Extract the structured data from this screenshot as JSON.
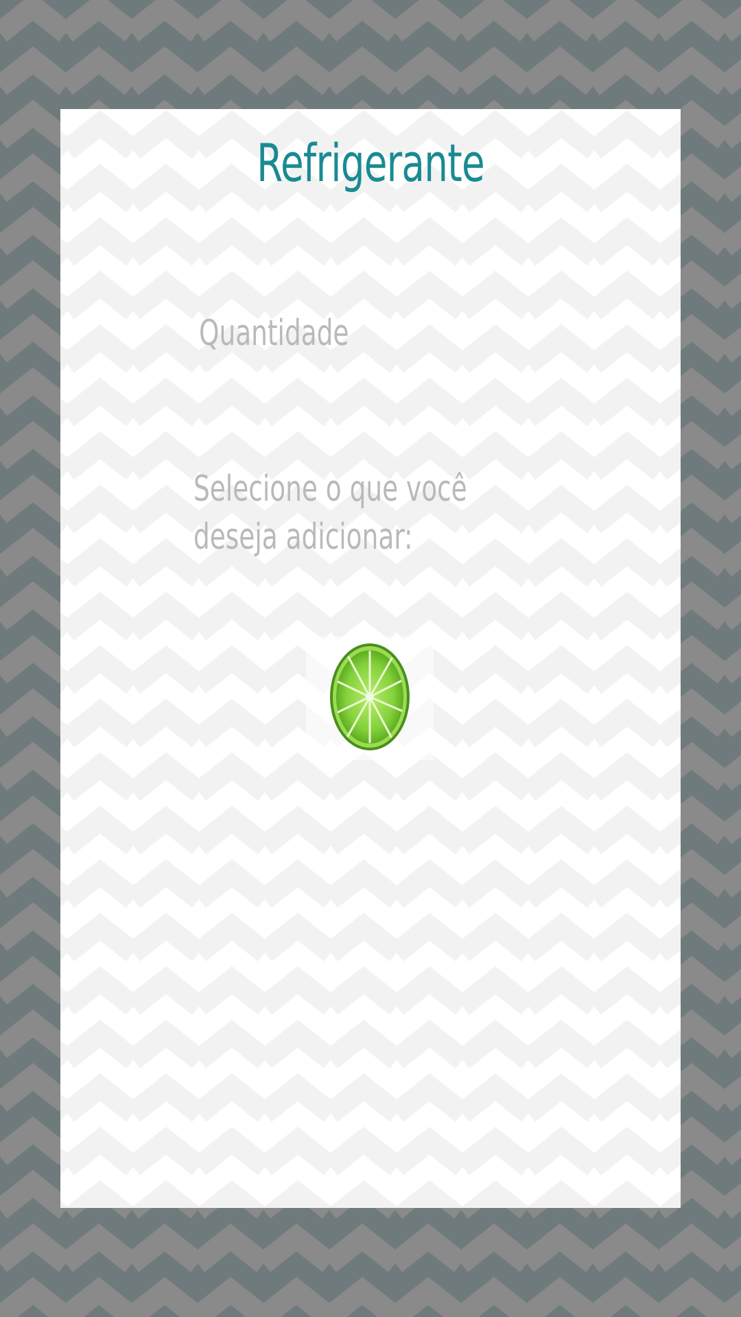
{
  "screen": {
    "title": "Refrigerante",
    "quantity_label": "Quantidade",
    "addons_prompt": "Selecione o que você deseja adicionar:"
  },
  "addons": [
    {
      "icon": "lime-slice-icon"
    }
  ],
  "colors": {
    "title": "#1a8a92",
    "label": "#b9b9b9",
    "outer_background": "#6f7a7c",
    "outer_chevron": "#8a8a8a",
    "card_background": "#ffffff",
    "card_chevron": "#f3f3f3",
    "lime": "#7ccf3c"
  }
}
